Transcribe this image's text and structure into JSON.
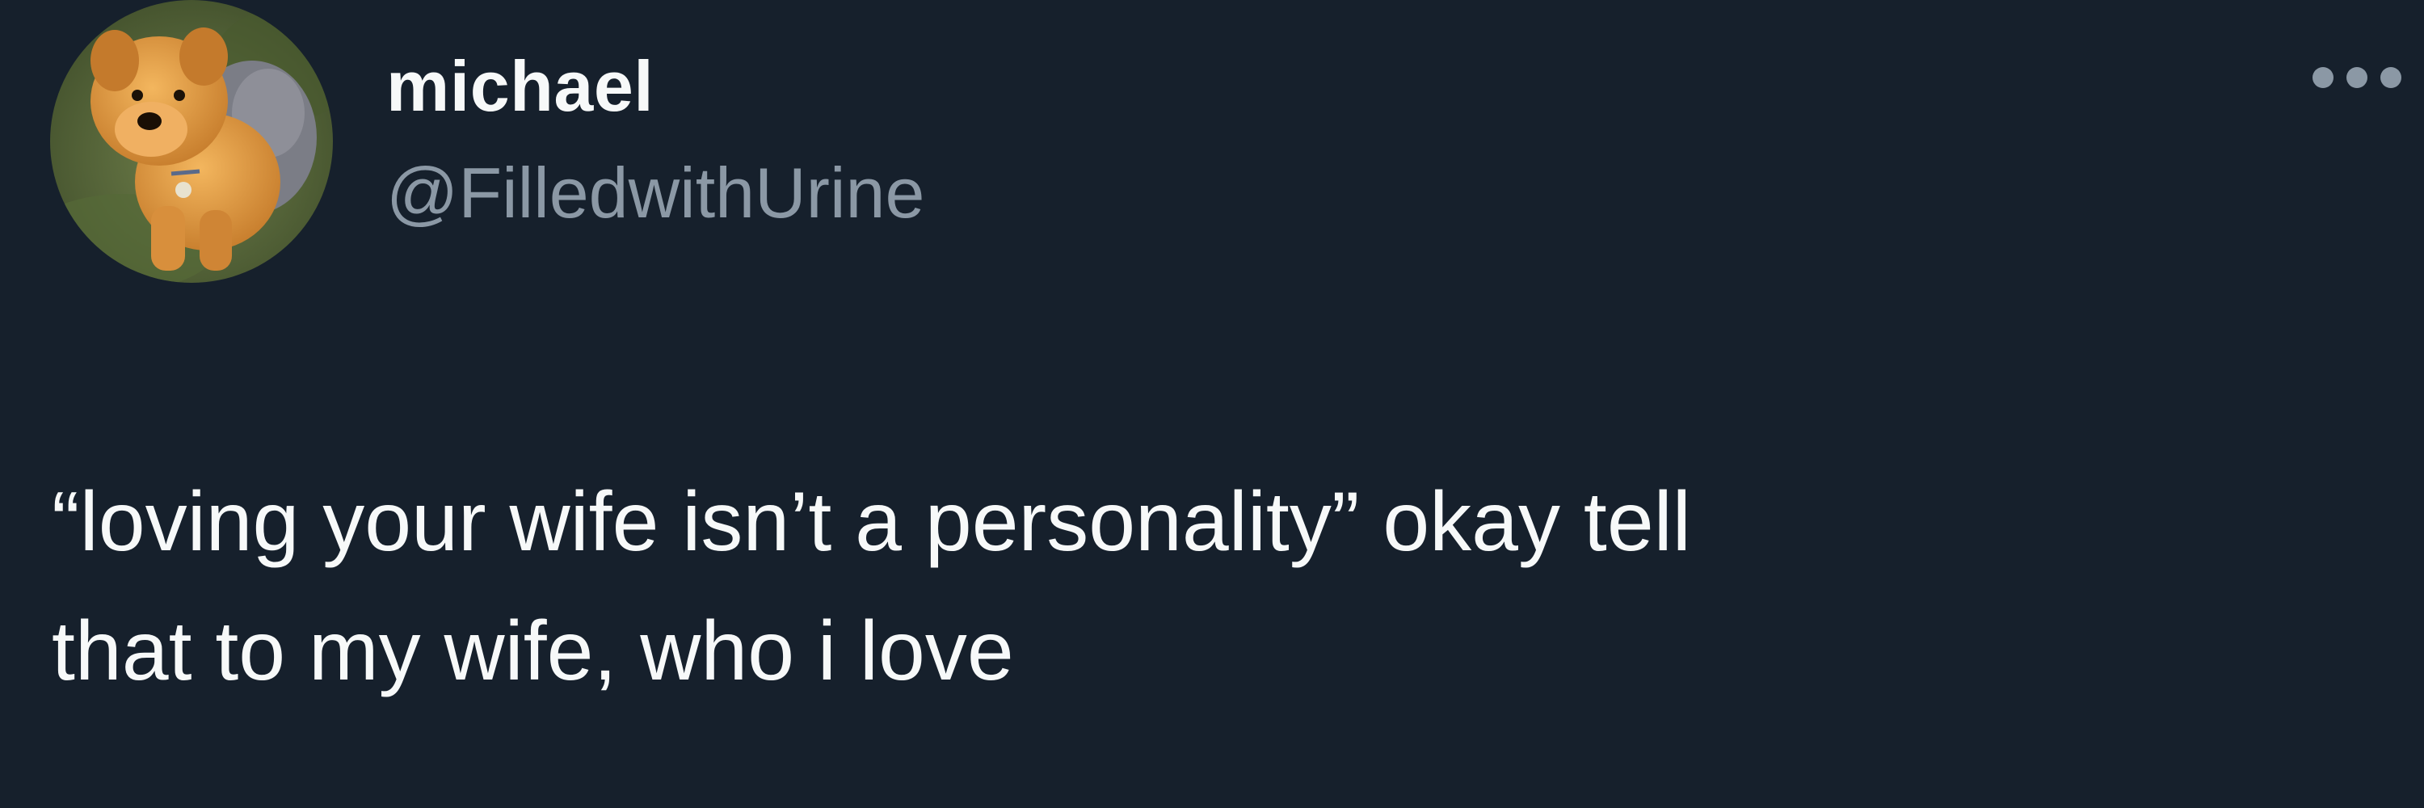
{
  "tweet": {
    "author": {
      "display_name": "michael",
      "handle": "@FilledwithUrine",
      "avatar_icon": "plush-dog-avatar"
    },
    "more_icon": "more-options-icon",
    "text": "“loving your wife isn’t a personality” okay tell\nthat to my wife, who i love"
  },
  "colors": {
    "background": "#16202c",
    "primary_text": "#f7f9f9",
    "secondary_text": "#8b98a5"
  }
}
